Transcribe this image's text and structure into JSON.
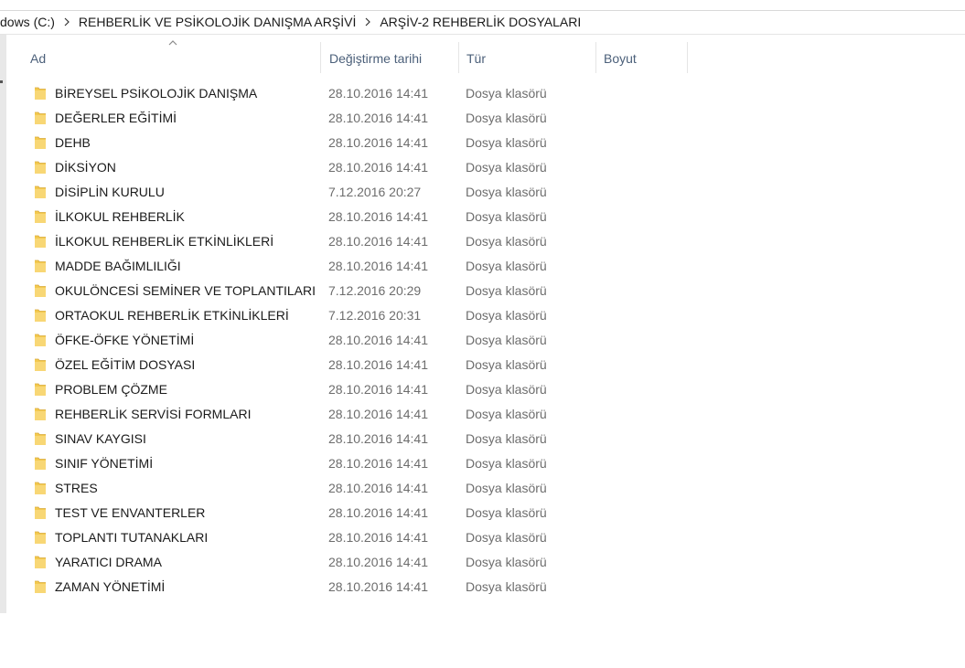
{
  "breadcrumb": {
    "items": [
      {
        "label": "dows (C:)"
      },
      {
        "label": "REHBERLİK VE PSİKOLOJİK DANIŞMA ARŞİVİ"
      },
      {
        "label": "ARŞİV-2 REHBERLİK DOSYALARI"
      }
    ]
  },
  "columns": {
    "name": "Ad",
    "date": "Değiştirme tarihi",
    "type": "Tür",
    "size": "Boyut",
    "sorted_by": "name",
    "sort_direction": "ascending"
  },
  "icons": {
    "folder": "folder-icon",
    "folder_color": "#f3c94f",
    "sort": "sort-up-icon",
    "chevron": "chevron-right-icon"
  },
  "files": [
    {
      "name": "BİREYSEL PSİKOLOJİK DANIŞMA",
      "date": "28.10.2016 14:41",
      "type": "Dosya klasörü",
      "size": ""
    },
    {
      "name": "DEĞERLER EĞİTİMİ",
      "date": "28.10.2016 14:41",
      "type": "Dosya klasörü",
      "size": ""
    },
    {
      "name": "DEHB",
      "date": "28.10.2016 14:41",
      "type": "Dosya klasörü",
      "size": ""
    },
    {
      "name": "DİKSİYON",
      "date": "28.10.2016 14:41",
      "type": "Dosya klasörü",
      "size": ""
    },
    {
      "name": "DİSİPLİN KURULU",
      "date": "7.12.2016 20:27",
      "type": "Dosya klasörü",
      "size": ""
    },
    {
      "name": "İLKOKUL REHBERLİK",
      "date": "28.10.2016 14:41",
      "type": "Dosya klasörü",
      "size": ""
    },
    {
      "name": "İLKOKUL REHBERLİK ETKİNLİKLERİ",
      "date": "28.10.2016 14:41",
      "type": "Dosya klasörü",
      "size": ""
    },
    {
      "name": "MADDE BAĞIMLILIĞI",
      "date": "28.10.2016 14:41",
      "type": "Dosya klasörü",
      "size": ""
    },
    {
      "name": "OKULÖNCESİ SEMİNER VE TOPLANTILARI",
      "date": "7.12.2016 20:29",
      "type": "Dosya klasörü",
      "size": ""
    },
    {
      "name": "ORTAOKUL REHBERLİK ETKİNLİKLERİ",
      "date": "7.12.2016 20:31",
      "type": "Dosya klasörü",
      "size": ""
    },
    {
      "name": "ÖFKE-ÖFKE YÖNETİMİ",
      "date": "28.10.2016 14:41",
      "type": "Dosya klasörü",
      "size": ""
    },
    {
      "name": "ÖZEL EĞİTİM DOSYASI",
      "date": "28.10.2016 14:41",
      "type": "Dosya klasörü",
      "size": ""
    },
    {
      "name": "PROBLEM ÇÖZME",
      "date": "28.10.2016 14:41",
      "type": "Dosya klasörü",
      "size": ""
    },
    {
      "name": "REHBERLİK SERVİSİ FORMLARI",
      "date": "28.10.2016 14:41",
      "type": "Dosya klasörü",
      "size": ""
    },
    {
      "name": "SINAV KAYGISI",
      "date": "28.10.2016 14:41",
      "type": "Dosya klasörü",
      "size": ""
    },
    {
      "name": "SINIF YÖNETİMİ",
      "date": "28.10.2016 14:41",
      "type": "Dosya klasörü",
      "size": ""
    },
    {
      "name": "STRES",
      "date": "28.10.2016 14:41",
      "type": "Dosya klasörü",
      "size": ""
    },
    {
      "name": "TEST VE ENVANTERLER",
      "date": "28.10.2016 14:41",
      "type": "Dosya klasörü",
      "size": ""
    },
    {
      "name": "TOPLANTI TUTANAKLARI",
      "date": "28.10.2016 14:41",
      "type": "Dosya klasörü",
      "size": ""
    },
    {
      "name": "YARATICI DRAMA",
      "date": "28.10.2016 14:41",
      "type": "Dosya klasörü",
      "size": ""
    },
    {
      "name": "ZAMAN YÖNETİMİ",
      "date": "28.10.2016 14:41",
      "type": "Dosya klasörü",
      "size": ""
    }
  ]
}
